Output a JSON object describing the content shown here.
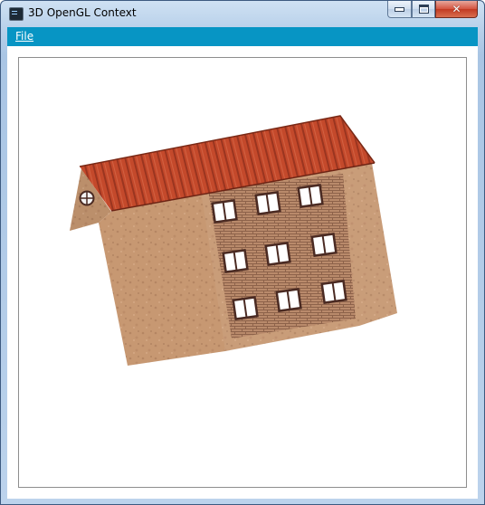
{
  "window": {
    "title": "3D OpenGL Context",
    "app_icon": "console-app-icon",
    "controls": {
      "minimize_icon": "minimize-icon",
      "maximize_icon": "maximize-icon",
      "close_icon": "close-icon",
      "close_glyph": "✕"
    }
  },
  "menubar": {
    "items": [
      {
        "label": "File"
      }
    ],
    "color": "#0795c4"
  },
  "scene": {
    "object": "house-3d-model",
    "colors": {
      "roof": "#c4492b",
      "roof_lines": "#8c2f1c",
      "stone_wall": "#c79872",
      "brick_panel": "#b5876a",
      "window_frame": "#4a2a22"
    }
  }
}
